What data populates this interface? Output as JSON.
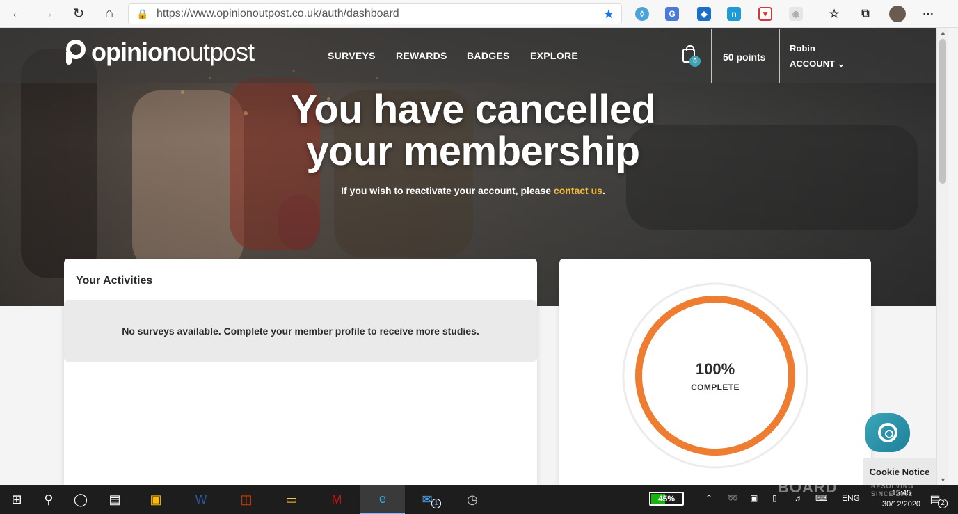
{
  "browser": {
    "url": "https://www.opinionoutpost.co.uk/auth/dashboard"
  },
  "site": {
    "logo_bold": "opinion",
    "logo_light": "outpost",
    "nav": [
      "SURVEYS",
      "REWARDS",
      "BADGES",
      "EXPLORE"
    ],
    "cart_count": "0",
    "points": "50 points",
    "user_name": "Robin",
    "account_label": "ACCOUNT"
  },
  "hero": {
    "headline_line1": "You have cancelled",
    "headline_line2": "your membership",
    "sub_prefix": "If you wish to reactivate your account, please ",
    "sub_link": "contact us",
    "sub_suffix": "."
  },
  "activities": {
    "title": "Your Activities",
    "empty_message": "No surveys available. Complete your member profile to receive more studies."
  },
  "profile_progress": {
    "percent_label": "100%",
    "status": "COMPLETE",
    "value": 1.0,
    "color": "#ef7d31"
  },
  "cookie": {
    "label": "Cookie Notice"
  },
  "taskbar": {
    "battery_label": "45%",
    "battery_level": 0.45,
    "language": "ENG",
    "time": "15:45",
    "date": "30/12/2020",
    "mail_badge": "1",
    "notification_badge": "2"
  },
  "watermark": {
    "text": "BOARD",
    "tagline_1": "RESOLVING",
    "tagline_2": "SINCE 2002"
  }
}
